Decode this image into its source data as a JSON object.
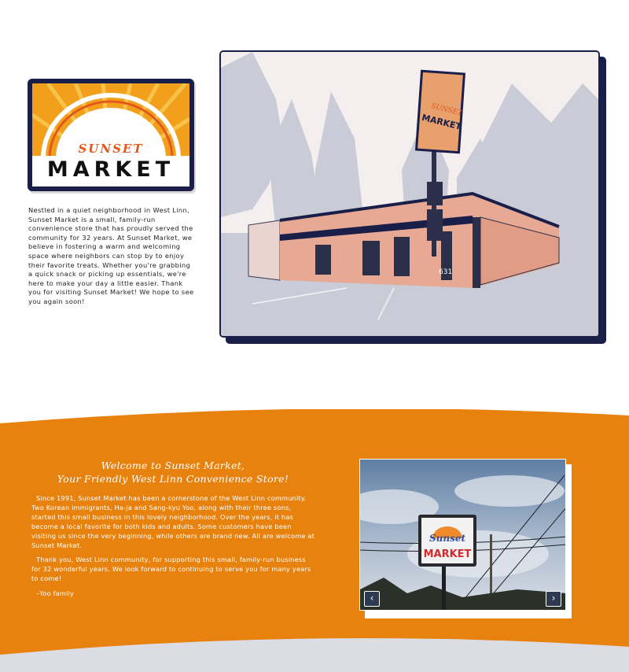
{
  "logo": {
    "line1": "SUNSET",
    "line2": "MARKET"
  },
  "intro": {
    "text": "Nestled in a quiet neighborhood in West Linn, Sunset Market is a small, family-run convenience store that has proudly served the community for 32 years. At Sunset Market, we believe in fostering a warm and welcoming space where neighbors can stop by to enjoy their favorite treats. Whether you're grabbing a quick snack or picking up essentials, we're here to make your day a little easier. Thank you for visiting Sunset Market! We hope to see you again soon!"
  },
  "hero": {
    "store_number": "631",
    "sign_line1": "SUNSET",
    "sign_line2": "MARKET"
  },
  "welcome": {
    "title_line1": "Welcome to Sunset Market,",
    "title_line2": "Your Friendly West Linn Convenience Store!",
    "para1": "Since 1991, Sunset Market has been a cornerstone of the West Linn community. Two Korean immigrants, Ha-ja and Sang-kyu Yoo, along with their three sons, started this small business in this lovely neighborhood. Over the years, it has become a local favorite for both kids and adults. Some customers have been visiting us since the very beginning, while others are brand new. All are welcome at Sunset Market.",
    "para2": "Thank you, West Linn community, for supporting this small, family-run business for 32 wonderful years. We look forward to continuing to serve you for many years to come!",
    "signature": "–Yoo family"
  },
  "carousel": {
    "sign_line1": "Sunset",
    "sign_line2": "MARKET",
    "prev_icon": "‹",
    "next_icon": "›"
  },
  "colors": {
    "navy": "#1a1f4a",
    "orange": "#e8820f",
    "logo_orange": "#f2a01c",
    "accent_red": "#e2581d"
  }
}
